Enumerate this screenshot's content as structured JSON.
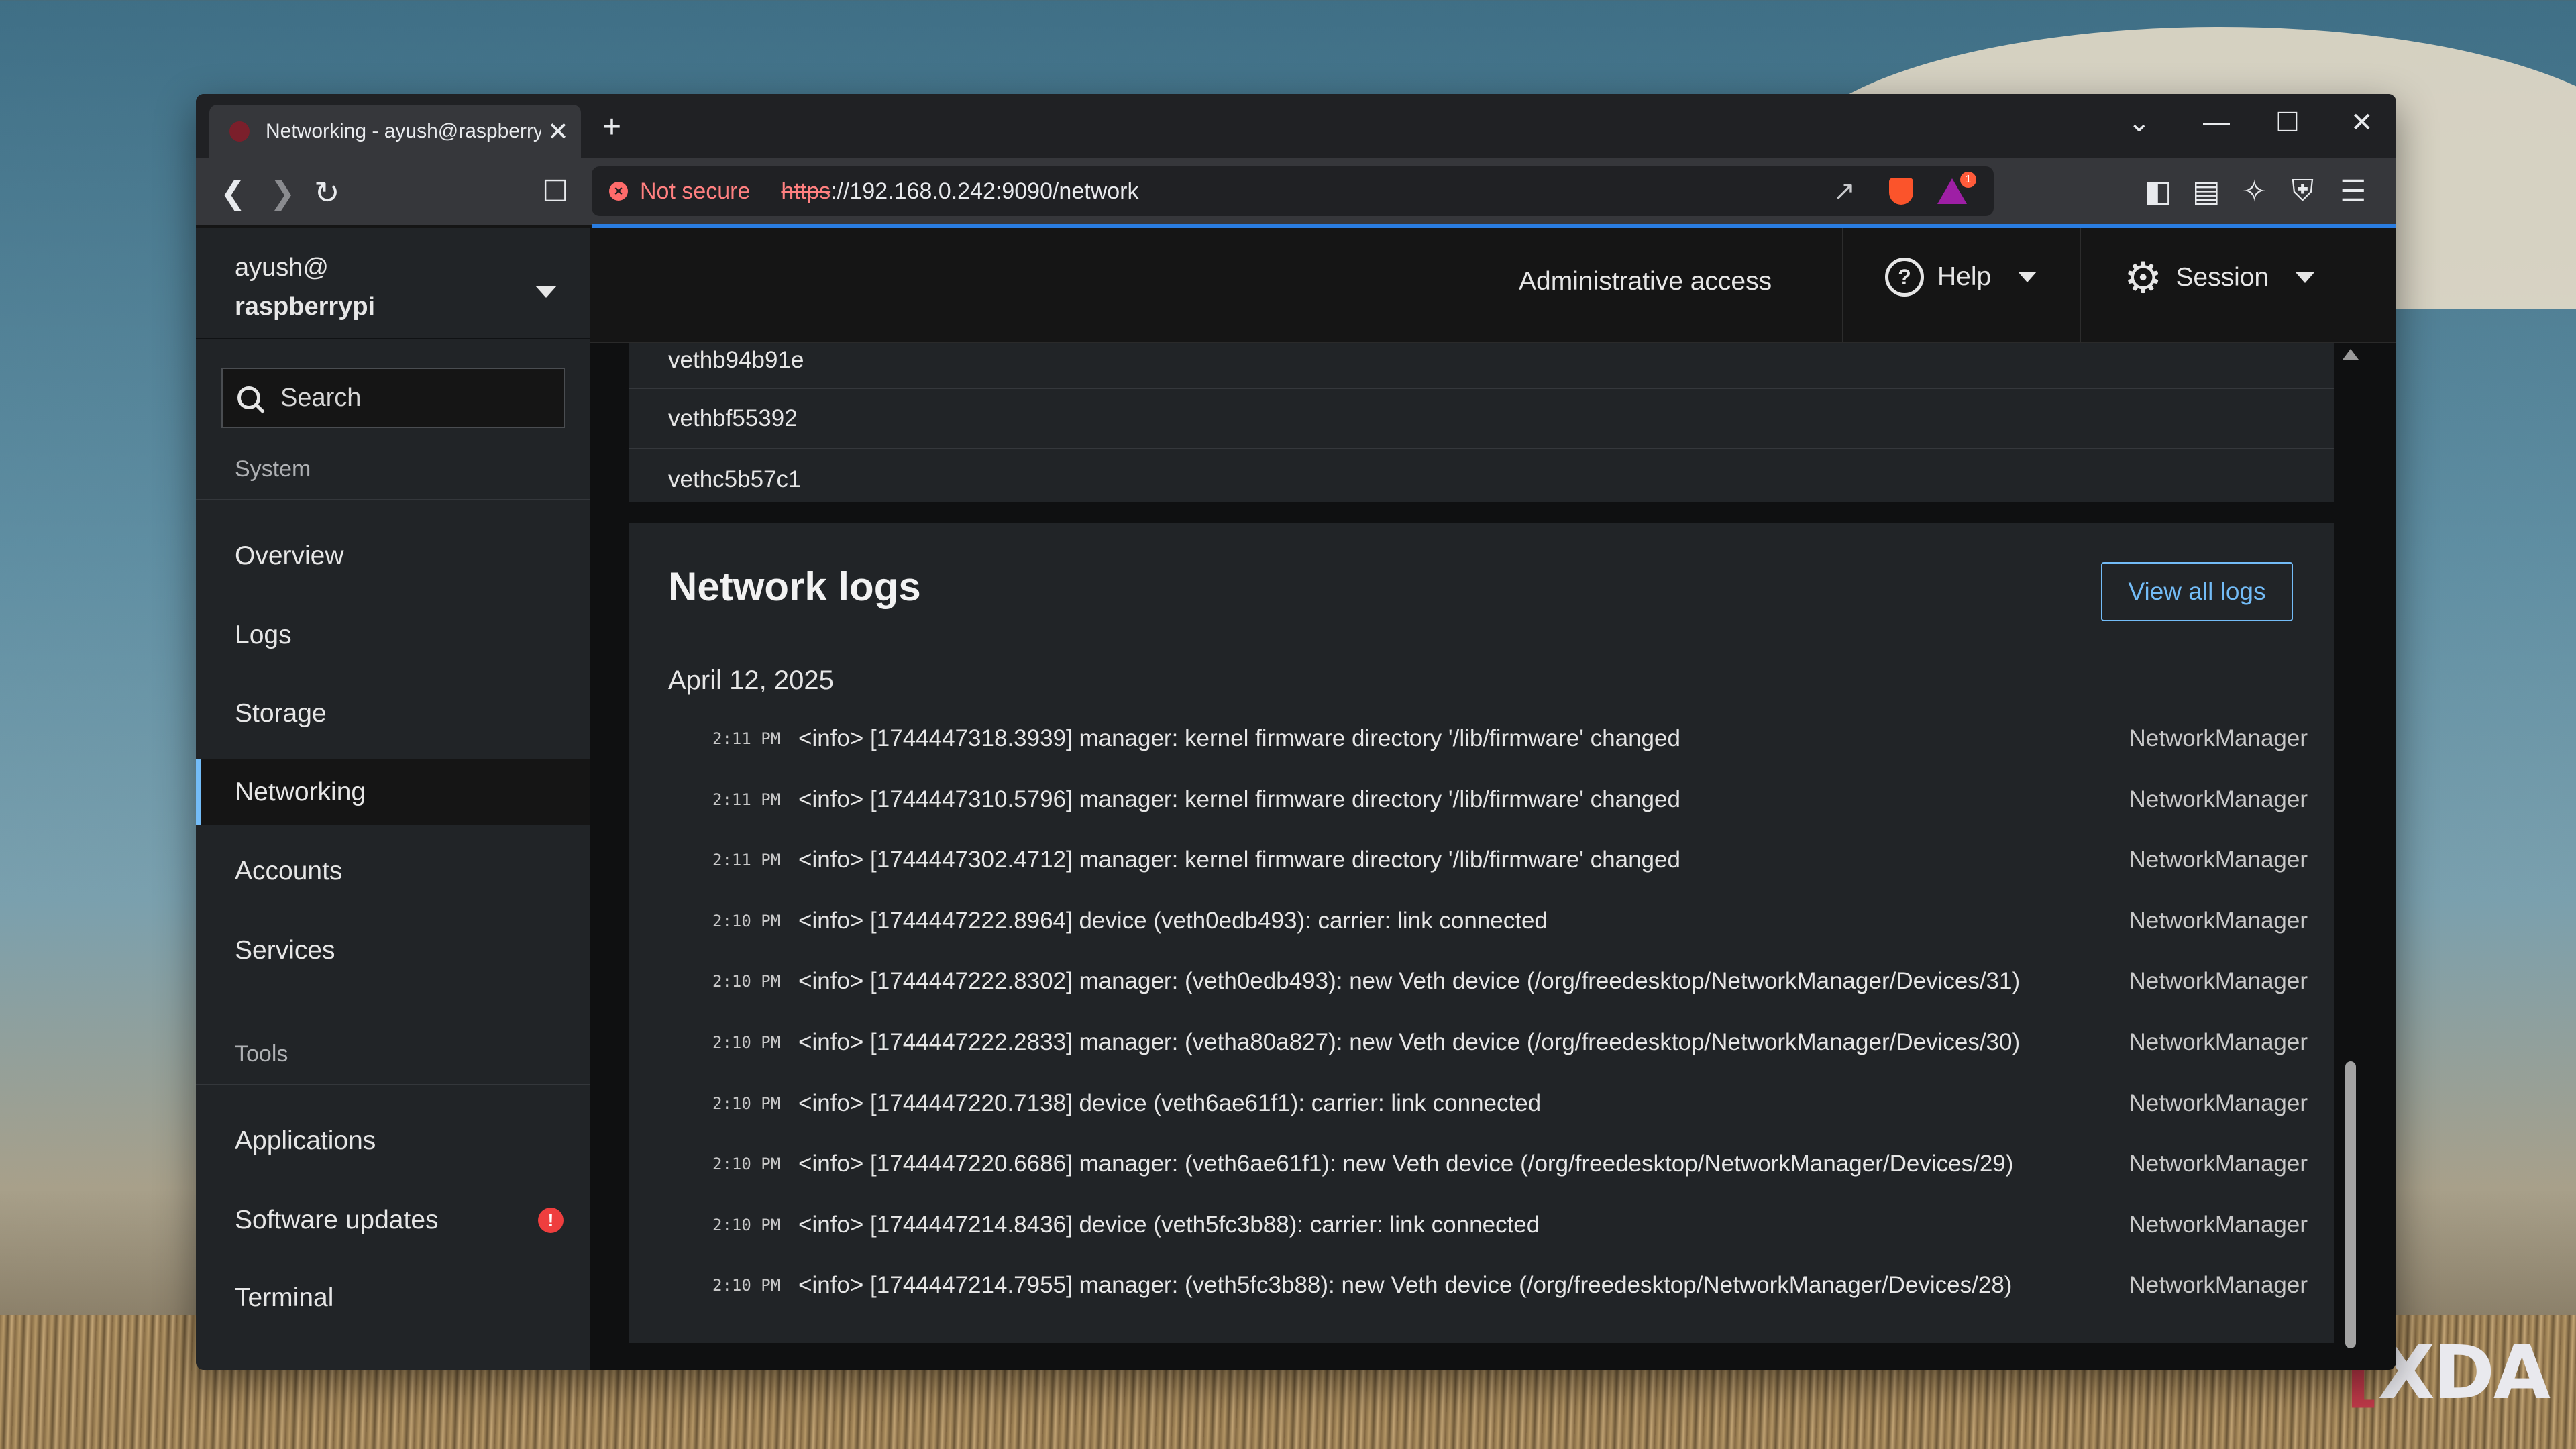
{
  "browser": {
    "tab_title": "Networking - ayush@raspberrypi",
    "tab_close": "✕",
    "new_tab": "+",
    "window_controls": {
      "list": "⌄",
      "minimize": "—",
      "maximize": "☐",
      "close": "✕"
    },
    "address": {
      "security_label": "Not secure",
      "scheme": "https",
      "rest": "://192.168.0.242:9090/network"
    },
    "rewards_badge": "1",
    "icons": [
      "back-icon",
      "forward-icon",
      "reload-icon",
      "bookmark-icon",
      "share-icon",
      "brave-shields-icon",
      "brave-rewards-icon",
      "sidebar-icon",
      "wallet-icon",
      "leo-icon",
      "vpn-icon",
      "menu-icon"
    ]
  },
  "sidebar": {
    "user": "ayush@",
    "host": "raspberrypi",
    "search_placeholder": "Search",
    "sections": [
      {
        "label": "System",
        "items": [
          "Overview",
          "Logs",
          "Storage",
          "Networking",
          "Accounts",
          "Services"
        ]
      },
      {
        "label": "Tools",
        "items": [
          "Applications",
          "Software updates",
          "Terminal"
        ]
      }
    ],
    "active_item": "Networking",
    "alert_item": "Software updates",
    "alert_glyph": "!"
  },
  "header": {
    "admin": "Administrative access",
    "help": "Help",
    "session": "Session"
  },
  "interfaces": [
    "vethb94b91e",
    "vethbf55392",
    "vethc5b57c1"
  ],
  "logs": {
    "title": "Network logs",
    "view_all": "View all logs",
    "date": "April 12, 2025",
    "entries": [
      {
        "time": "2:11 PM",
        "msg": "<info> [1744447318.3939] manager: kernel firmware directory '/lib/firmware' changed",
        "src": "NetworkManager"
      },
      {
        "time": "2:11 PM",
        "msg": "<info> [1744447310.5796] manager: kernel firmware directory '/lib/firmware' changed",
        "src": "NetworkManager"
      },
      {
        "time": "2:11 PM",
        "msg": "<info> [1744447302.4712] manager: kernel firmware directory '/lib/firmware' changed",
        "src": "NetworkManager"
      },
      {
        "time": "2:10 PM",
        "msg": "<info> [1744447222.8964] device (veth0edb493): carrier: link connected",
        "src": "NetworkManager"
      },
      {
        "time": "2:10 PM",
        "msg": "<info> [1744447222.8302] manager: (veth0edb493): new Veth device (/org/freedesktop/NetworkManager/Devices/31)",
        "src": "NetworkManager"
      },
      {
        "time": "2:10 PM",
        "msg": "<info> [1744447222.2833] manager: (vetha80a827): new Veth device (/org/freedesktop/NetworkManager/Devices/30)",
        "src": "NetworkManager"
      },
      {
        "time": "2:10 PM",
        "msg": "<info> [1744447220.7138] device (veth6ae61f1): carrier: link connected",
        "src": "NetworkManager"
      },
      {
        "time": "2:10 PM",
        "msg": "<info> [1744447220.6686] manager: (veth6ae61f1): new Veth device (/org/freedesktop/NetworkManager/Devices/29)",
        "src": "NetworkManager"
      },
      {
        "time": "2:10 PM",
        "msg": "<info> [1744447214.8436] device (veth5fc3b88): carrier: link connected",
        "src": "NetworkManager"
      },
      {
        "time": "2:10 PM",
        "msg": "<info> [1744447214.7955] manager: (veth5fc3b88): new Veth device (/org/freedesktop/NetworkManager/Devices/28)",
        "src": "NetworkManager"
      }
    ]
  },
  "watermark": {
    "bracket": "[",
    "text": "XDA"
  }
}
